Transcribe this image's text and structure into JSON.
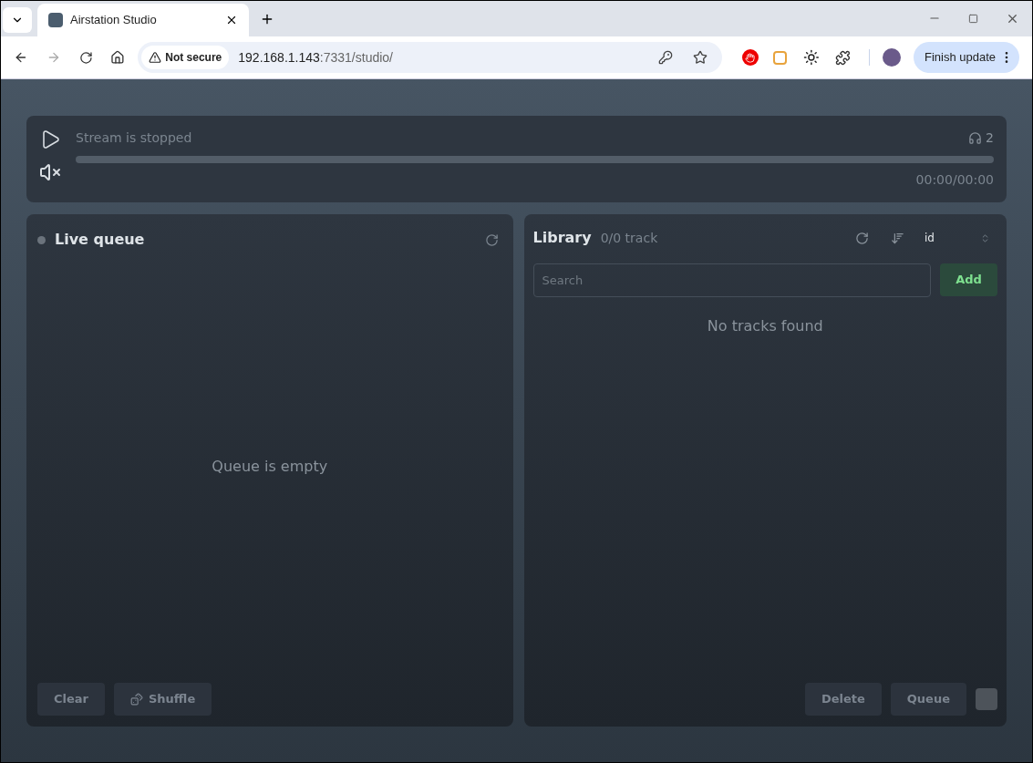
{
  "browser": {
    "tab_title": "Airstation Studio",
    "security_label": "Not secure",
    "url_host": "192.168.1.143",
    "url_rest": ":7331/studio/",
    "update_button": "Finish update"
  },
  "player": {
    "status": "Stream is stopped",
    "listeners": "2",
    "time": "00:00/00:00",
    "level": 0,
    "muted": true
  },
  "queue": {
    "title": "Live queue",
    "live": false,
    "empty_text": "Queue is empty",
    "buttons": [
      {
        "label": "Clear",
        "kind": "plain",
        "disabled": true
      },
      {
        "label": "Shuffle",
        "kind": "dice",
        "disabled": true
      }
    ]
  },
  "library": {
    "title": "Library",
    "count": "0/0 track",
    "sort_field": "id",
    "search": {
      "placeholder": "Search"
    },
    "add_button": "Add",
    "empty_text": "No tracks found",
    "buttons": [
      {
        "label": "Delete",
        "disabled": true
      },
      {
        "label": "Queue",
        "disabled": true
      }
    ],
    "select_all": {
      "checked": false
    }
  }
}
